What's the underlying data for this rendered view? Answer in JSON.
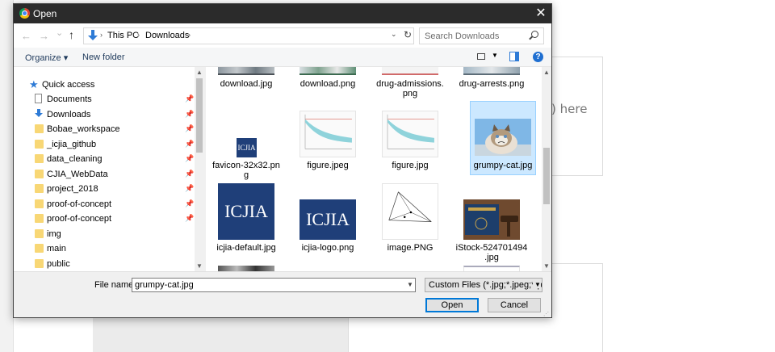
{
  "background_page": {
    "upload_hint": ") here"
  },
  "dialog": {
    "title": "Open",
    "close_glyph": "✕",
    "nav": {
      "back": "←",
      "forward": "→",
      "recent": "⌄",
      "up": "↑"
    },
    "breadcrumb": [
      "This PC",
      "Downloads"
    ],
    "search_placeholder": "Search Downloads",
    "toolbar": {
      "organize": "Organize ▾",
      "new_folder": "New folder",
      "help": "?"
    },
    "sidebar": {
      "quick_access": "Quick access",
      "items": [
        {
          "label": "Documents",
          "icon": "document-icon",
          "pinned": true
        },
        {
          "label": "Downloads",
          "icon": "download-icon",
          "pinned": true
        },
        {
          "label": "Bobae_workspace",
          "icon": "folder-icon",
          "pinned": true
        },
        {
          "label": "_icjia_github",
          "icon": "folder-icon",
          "pinned": true
        },
        {
          "label": "data_cleaning",
          "icon": "folder-icon",
          "pinned": true
        },
        {
          "label": "CJIA_WebData",
          "icon": "folder-icon",
          "pinned": true
        },
        {
          "label": "project_2018",
          "icon": "folder-icon",
          "pinned": true
        },
        {
          "label": "proof-of-concept",
          "icon": "folder-icon",
          "pinned": true
        },
        {
          "label": "proof-of-concept",
          "icon": "folder-icon",
          "pinned": true
        },
        {
          "label": "img",
          "icon": "folder-icon",
          "pinned": false
        },
        {
          "label": "main",
          "icon": "folder-icon",
          "pinned": false
        },
        {
          "label": "public",
          "icon": "folder-icon",
          "pinned": false
        }
      ]
    },
    "files": [
      {
        "name": "download.jpg",
        "kind": "photo-partial"
      },
      {
        "name": "download.png",
        "kind": "photo-partial"
      },
      {
        "name": "drug-admissions.\npng",
        "kind": "chart-partial"
      },
      {
        "name": "drug-arrests.png",
        "kind": "photo-partial"
      },
      {
        "name": "favicon-32x32.pn\ng",
        "kind": "icjia-small"
      },
      {
        "name": "figure.jpeg",
        "kind": "chart"
      },
      {
        "name": "figure.jpg",
        "kind": "chart"
      },
      {
        "name": "grumpy-cat.jpg",
        "kind": "cat",
        "selected": true
      },
      {
        "name": "icjia-default.jpg",
        "kind": "icjia-logo"
      },
      {
        "name": "icjia-logo.png",
        "kind": "icjia-logo"
      },
      {
        "name": "image.PNG",
        "kind": "diagram"
      },
      {
        "name": "iStock-524701494\n.jpg",
        "kind": "law-book"
      }
    ],
    "icjia_text": "ICJIA",
    "file_name_label": "File name:",
    "file_name_value": "grumpy-cat.jpg",
    "file_type": "Custom Files (*.jpg;*.jpeg;*.png)",
    "open_button": "Open",
    "cancel_button": "Cancel",
    "colors": {
      "icjia_blue": "#1f3f79",
      "selection": "#cce8ff",
      "chart_line": "#2aa7b8"
    }
  }
}
